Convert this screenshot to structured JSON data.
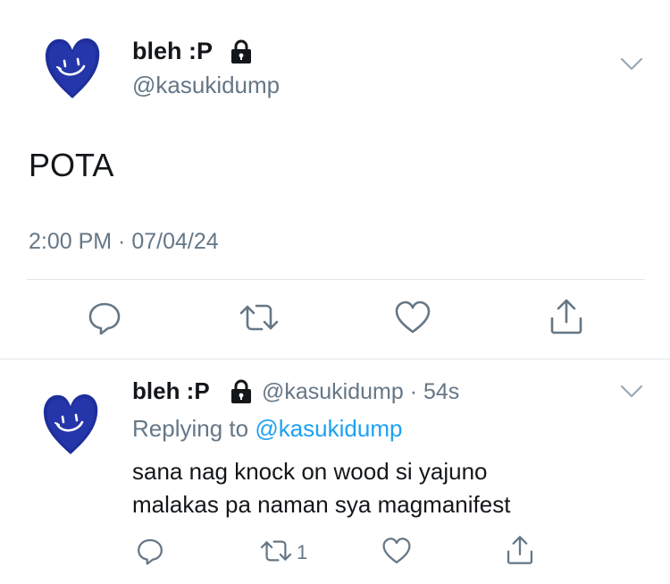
{
  "main_tweet": {
    "display_name": "bleh :P",
    "handle": "@kasukidump",
    "text": "POTA",
    "timestamp": "2:00 PM · 07/04/24",
    "icons": [
      "avatar-heart-smiley",
      "lock-icon",
      "chevron-down-icon",
      "reply-icon",
      "retweet-icon",
      "like-icon",
      "share-icon"
    ]
  },
  "reply_tweet": {
    "display_name": "bleh :P",
    "handle_time": "@kasukidump · 54s",
    "replying_prefix": "Replying to ",
    "replying_mention": "@kasukidump",
    "text_line1": "sana nag knock on wood si yajuno",
    "text_line2": "malakas pa naman sya magmanifest",
    "retweet_count": "1"
  },
  "colors": {
    "text": "#14171a",
    "secondary": "#657786",
    "link": "#1da1f2",
    "divider": "#e1e8ed",
    "avatar_blue": "#1e2f9c"
  }
}
